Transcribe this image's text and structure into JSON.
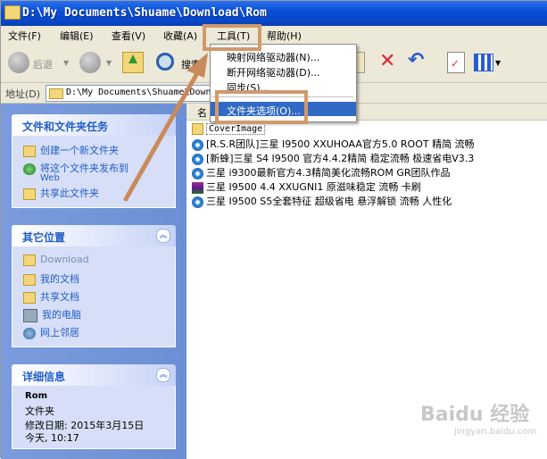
{
  "window": {
    "title": "D:\\My Documents\\Shuame\\Download\\Rom"
  },
  "menubar": {
    "file": "文件(F)",
    "edit": "编辑(E)",
    "view": "查看(V)",
    "favorites": "收藏(A)",
    "tools": "工具(T)",
    "help": "帮助(H)"
  },
  "toolbar": {
    "back": "后退",
    "search": "搜索"
  },
  "address": {
    "label": "地址(D)",
    "value": "D:\\My Documents\\Shuame\\Down"
  },
  "tools_menu": {
    "items": [
      "映射网络驱动器(N)...",
      "断开网络驱动器(D)...",
      "同步(S)...",
      "文件夹选项(O)..."
    ],
    "selected_index": 3
  },
  "left_panel": {
    "tasks": {
      "title": "文件和文件夹任务",
      "items": [
        "创建一个新文件夹",
        "将这个文件夹发布到",
        "Web",
        "共享此文件夹"
      ]
    },
    "places": {
      "title": "其它位置",
      "items": [
        "Download",
        "我的文档",
        "共享文档",
        "我的电脑",
        "网上邻居"
      ]
    },
    "details": {
      "title": "详细信息",
      "name": "Rom",
      "type": "文件夹",
      "modified_label": "修改日期: 2015年3月15日",
      "modified_time": "今天, 10:17"
    }
  },
  "file_list": {
    "column": "名",
    "items": [
      {
        "name": "CoverImage",
        "icon": "folder-icon"
      },
      {
        "name": "[R.S.R团队]三星 I9500 XXUHOAA官方5.0 ROOT 精简 流畅",
        "icon": "disc-icon"
      },
      {
        "name": "[新蜂]三星 S4 I9500 官方4.4.2精简 稳定流畅 极速省电V3.3",
        "icon": "disc-icon"
      },
      {
        "name": "三星 i9300最新官方4.3精简美化流畅ROM GR团队作品",
        "icon": "disc-icon"
      },
      {
        "name": "三星 I9500 4.4 XXUGNI1 原滋味稳定 流畅 卡刷",
        "icon": "rar-icon"
      },
      {
        "name": "三星 I9500 S5全套特征 超级省电 悬浮解锁 流畅 人性化",
        "icon": "disc-icon"
      }
    ]
  },
  "watermark": {
    "text": "Baidu 经验",
    "sub": "jingyan.baidu.com"
  },
  "colors": {
    "title_bar": "#0a4fd6",
    "highlight_box": "#d09a6c",
    "menu_selected": "#316ac5",
    "left_pane": "#7a9cde"
  }
}
